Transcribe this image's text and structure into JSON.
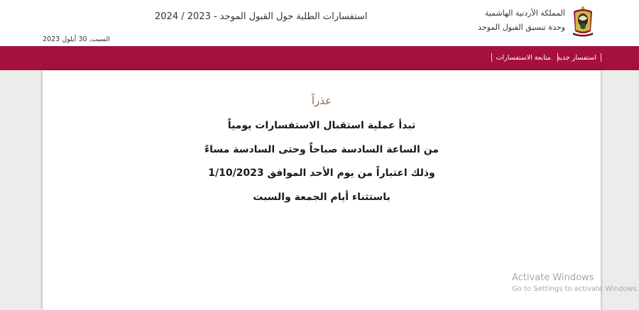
{
  "header": {
    "kingdom": "المملكة الأردنية الهاشمية",
    "unit": "وحدة تنسيق القبول الموحد",
    "site_title": "استفسارات الطلبة حول القبول الموحد - 2023 / 2024",
    "date": "السبت, 30 أيلول 2023",
    "emblem_icon": "jordan-coat-of-arms-icon"
  },
  "nav": {
    "new_inquiry": "استفسار جديد",
    "follow_up": "متابعة الاستفسارات"
  },
  "message": {
    "title": "عذراً",
    "line1": "تبدأ عملية استقبال الاستفسارات يومياً",
    "line2": "من الساعة السادسة صباحاً وحتى السادسة مساءً",
    "line3": "وذلك اعتباراً من يوم الأحد الموافق 1/10/2023",
    "line4": "باستثناء أيام الجمعة والسبت"
  },
  "watermark": {
    "line1": "Activate Windows",
    "line2": "Go to Settings to activate Windows."
  },
  "colors": {
    "navbar": "#a5113c",
    "title_accent": "#8b6a45",
    "background": "#ececec"
  }
}
